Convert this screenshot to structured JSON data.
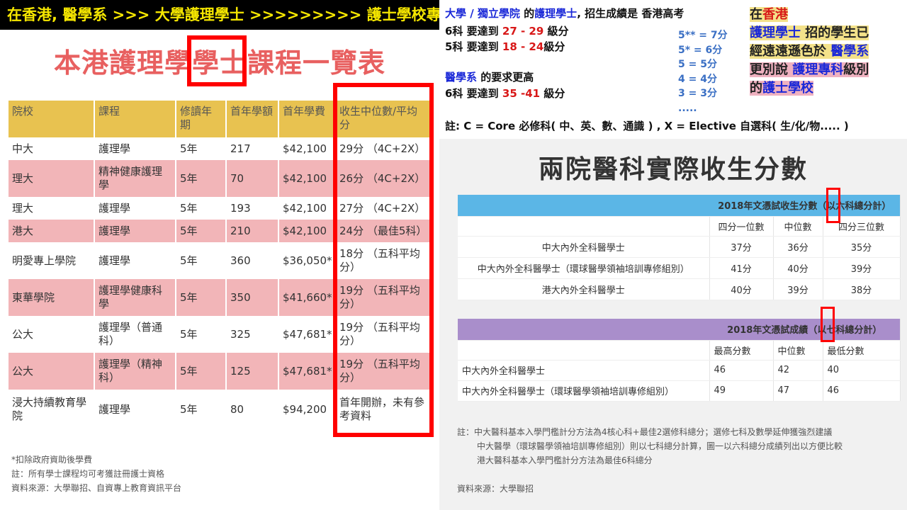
{
  "banner": "在香港, 醫學系 >>> 大學護理學士 >>>>>>>>> 護士學校專科",
  "left": {
    "title": "本港護理學學士課程一覽表",
    "headers": [
      "院校",
      "課程",
      "修讀年期",
      "首年學額",
      "首年學費",
      "收生中位數/平均分"
    ],
    "rows": [
      {
        "school": "中大",
        "course": "護理學",
        "years": "5年",
        "places": "217",
        "fee": "$42,100",
        "score": "29分 （4C+2X）"
      },
      {
        "school": "理大",
        "course": "精神健康護理學",
        "years": "5年",
        "places": "70",
        "fee": "$42,100",
        "score": "26分 （4C+2X）"
      },
      {
        "school": "理大",
        "course": "護理學",
        "years": "5年",
        "places": "193",
        "fee": "$42,100",
        "score": "27分 （4C+2X）"
      },
      {
        "school": "港大",
        "course": "護理學",
        "years": "5年",
        "places": "210",
        "fee": "$42,100",
        "score": "24分 （最佳5科）"
      },
      {
        "school": "明愛專上學院",
        "course": "護理學",
        "years": "5年",
        "places": "360",
        "fee": "$36,050*",
        "score": "18分 （五科平均分）"
      },
      {
        "school": "東華學院",
        "course": "護理學健康科學",
        "years": "5年",
        "places": "350",
        "fee": "$41,660*",
        "score": "19分 （五科平均分）"
      },
      {
        "school": "公大",
        "course": "護理學（普通科）",
        "years": "5年",
        "places": "325",
        "fee": "$47,681*",
        "score": "19分 （五科平均分）"
      },
      {
        "school": "公大",
        "course": "護理學（精神科）",
        "years": "5年",
        "places": "125",
        "fee": "$47,681*",
        "score": "19分 （五科平均分）"
      },
      {
        "school": "浸大持續教育學院",
        "course": "護理學",
        "years": "5年",
        "places": "80",
        "fee": "$94,200",
        "score": "首年開辦，未有參考資料"
      }
    ],
    "notes": [
      "*扣除政府資助後學費",
      "註：所有學士課程均可考獲註冊護士資格",
      "資料來源：大學聯招、自資專上教育資訊平台"
    ]
  },
  "right_top": {
    "line1_a": "大學 / 獨立學院",
    "line1_b": " 的",
    "line1_c": "護理學士",
    "line1_d": ", 招生成績是 香港高考",
    "line2_a": "6科 要達到 ",
    "line2_b": "27 - 29",
    "line2_c": " 級分",
    "line3_a": "5科 要達到 ",
    "line3_b": "18 - 24",
    "line3_c": "級分",
    "line4_a": "醫學系",
    "line4_b": " 的要求更高",
    "line5_a": "6科 要達到 ",
    "line5_b": "35 -41",
    "line5_c": " 級分",
    "note": "註: C = Core 必修科( 中、英、數、通識 ) , X = Elective 自選科( 生/化/物..... )",
    "grades": [
      "5** = 7分",
      "5* = 6分",
      "5 = 5分",
      "4 = 4分",
      "3 = 3分",
      "....."
    ],
    "callout": {
      "l1a": "在",
      "l1b": "香港",
      "l2a": "護理學士",
      "l2b": " 招的學生已",
      "l3a": "經遠遠遜色於 ",
      "l3b": "醫學系",
      "l4a": "更別說 ",
      "l4b": "護理專科",
      "l4c": "級別",
      "l5a": "的",
      "l5b": "護士學校"
    }
  },
  "right_bottom": {
    "title": "兩院醫科實際收生分數",
    "t1": {
      "header": "2018年文憑試收生分數（以六科總分計）",
      "cols": [
        "四分一位數",
        "中位數",
        "四分三位數"
      ],
      "rows": [
        {
          "name": "中大內外全科醫學士",
          "v": [
            "37分",
            "36分",
            "35分"
          ]
        },
        {
          "name": "中大內外全科醫學士（環球醫學領袖培訓專修組別）",
          "v": [
            "41分",
            "40分",
            "39分"
          ]
        },
        {
          "name": "港大內外全科醫學士",
          "v": [
            "40分",
            "39分",
            "38分"
          ]
        }
      ]
    },
    "t2": {
      "header": "2018年文憑試成績（以七科總分計）",
      "cols": [
        "最高分數",
        "中位數",
        "最低分數"
      ],
      "rows": [
        {
          "name": "中大內外全科醫學士",
          "v": [
            "46",
            "42",
            "40"
          ]
        },
        {
          "name": "中大內外全科醫學士（環球醫學領袖培訓專修組別）",
          "v": [
            "49",
            "47",
            "46"
          ]
        }
      ]
    },
    "footnotes": [
      "註：中大醫科基本入學門檻計分方法為4核心科+最佳2選修科總分；選修七科及數學延伸獲強烈建議",
      "中大醫學（環球醫學領袖培訓專修組別）則以七科總分計算，圖一以六科總分成績列出以方便比較",
      "港大醫科基本入學門檻計分方法為最佳6科總分"
    ],
    "source": "資料來源：大學聯招"
  },
  "colors": {
    "banner_bg": "#000000",
    "banner_text": "#f5e600",
    "table_header": "#e8c250",
    "row_pink": "#f2b5b8",
    "highlight_red": "#ff0000",
    "t1_header": "#5bb6e6",
    "t2_header": "#a98ecb"
  }
}
